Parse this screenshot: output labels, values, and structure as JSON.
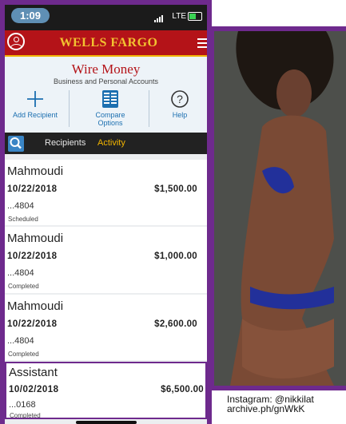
{
  "status_bar": {
    "time": "1:09",
    "network": "LTE"
  },
  "app": {
    "brand": "WELLS FARGO"
  },
  "header": {
    "title": "Wire Money",
    "subtitle": "Business and Personal Accounts"
  },
  "actions": [
    {
      "label": "Add Recipient",
      "icon": "plus-icon"
    },
    {
      "label": "Compare Options",
      "icon": "compare-document-icon"
    },
    {
      "label": "Help",
      "icon": "help-question-icon"
    }
  ],
  "tabs": [
    {
      "label": "Recipients",
      "active": false
    },
    {
      "label": "Activity",
      "active": true
    }
  ],
  "transactions": [
    {
      "name": "Mahmoudi",
      "date": "10/22/2018",
      "amount": "$1,500.00",
      "account": "...4804",
      "status": "Scheduled"
    },
    {
      "name": "Mahmoudi",
      "date": "10/22/2018",
      "amount": "$1,000.00",
      "account": "...4804",
      "status": "Completed"
    },
    {
      "name": "Mahmoudi",
      "date": "10/22/2018",
      "amount": "$2,600.00",
      "account": "...4804",
      "status": "Completed"
    },
    {
      "name": "Assistant",
      "date": "10/02/2018",
      "amount": "$6,500.00",
      "account": "...0168",
      "status": "Completed"
    }
  ],
  "caption": {
    "line1": "Instagram: @nikkilat",
    "line2": "archive.ph/gnWkK"
  },
  "colors": {
    "brand_red": "#b41318",
    "brand_gold": "#f2b400",
    "frame_purple": "#6e2a8d",
    "link_blue": "#1c6fb0",
    "active_tab": "#f2b400"
  }
}
